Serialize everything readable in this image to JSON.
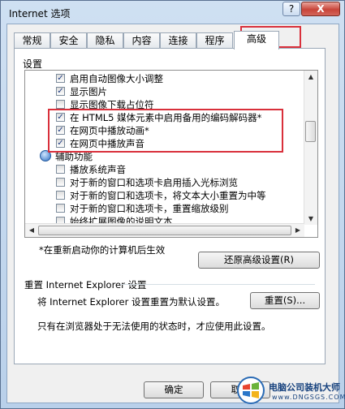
{
  "window": {
    "title": "Internet 选项",
    "help_label": "?",
    "close_label": "X"
  },
  "tabs": [
    "常规",
    "安全",
    "隐私",
    "内容",
    "连接",
    "程序",
    "高级"
  ],
  "settings": {
    "group_label": "设置",
    "items": [
      {
        "label": "启用自动图像大小调整",
        "checked": true
      },
      {
        "label": "显示图片",
        "checked": true
      },
      {
        "label": "显示图像下载占位符",
        "checked": false
      },
      {
        "label": "在 HTML5 媒体元素中启用备用的编码解码器*",
        "checked": true
      },
      {
        "label": "在网页中播放动画*",
        "checked": true
      },
      {
        "label": "在网页中播放声音",
        "checked": true
      },
      {
        "label": "辅助功能",
        "category": true
      },
      {
        "label": "播放系统声音",
        "checked": false
      },
      {
        "label": "对于新的窗口和选项卡启用插入光标浏览",
        "checked": false
      },
      {
        "label": "对于新的窗口和选项卡，将文本大小重置为中等",
        "checked": false
      },
      {
        "label": "对于新的窗口和选项卡，重置缩放级别",
        "checked": false
      },
      {
        "label": "始终扩展图像的说明文本",
        "checked": false
      }
    ],
    "restart_note": "*在重新启动你的计算机后生效",
    "restore_button": "还原高级设置(R)"
  },
  "reset": {
    "group_label": "重置 Internet Explorer 设置",
    "description": "将 Internet Explorer 设置重置为默认设置。",
    "button": "重置(S)...",
    "warning": "只有在浏览器处于无法使用的状态时，才应使用此设置。"
  },
  "footer": {
    "ok": "确定",
    "cancel": "取消"
  },
  "watermark": {
    "title": "电脑公司装机大师",
    "url": "www.DNGSGS.COM"
  },
  "colors": {
    "highlight": "#d9303b",
    "check": "#1d3b82"
  }
}
